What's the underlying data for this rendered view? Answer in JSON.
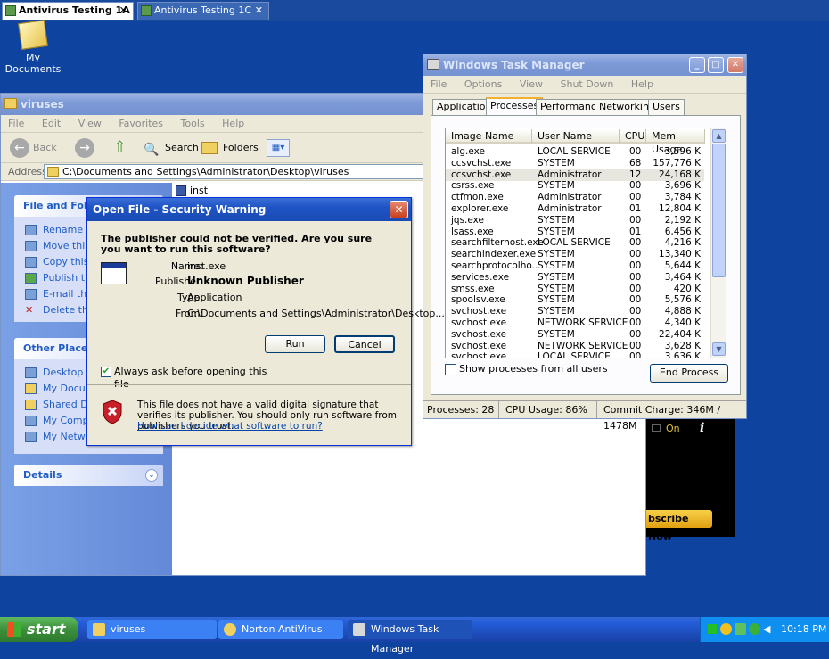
{
  "vm_tabs": [
    {
      "label": "Antivirus Testing 1A",
      "active": true
    },
    {
      "label": "Antivirus Testing 1C",
      "active": false
    }
  ],
  "desktop": {
    "my_documents": "My Documents"
  },
  "explorer": {
    "title": "viruses",
    "menu": [
      "File",
      "Edit",
      "View",
      "Favorites",
      "Tools",
      "Help"
    ],
    "toolbar": {
      "back": "Back",
      "search": "Search",
      "folders": "Folders"
    },
    "address_label": "Address",
    "address": "C:\\Documents and Settings\\Administrator\\Desktop\\viruses",
    "file_item": "inst",
    "tasks_title": "File and Folder Tasks",
    "file_tasks": [
      "Rename this file",
      "Move this file",
      "Copy this file",
      "Publish this file",
      "E-mail this file",
      "Delete this file"
    ],
    "other_places_title": "Other Places",
    "other_places": [
      "Desktop",
      "My Documents",
      "Shared Documents",
      "My Computer",
      "My Network Places"
    ],
    "details_title": "Details"
  },
  "security_dialog": {
    "title": "Open File - Security Warning",
    "question": "The publisher could not be verified.  Are you sure you want to run this software?",
    "name_label": "Name:",
    "name_value": "inst.exe",
    "publisher_label": "Publisher:",
    "publisher_value": "Unknown Publisher",
    "type_label": "Type:",
    "type_value": "Application",
    "from_label": "From:",
    "from_value": "C:\\Documents and Settings\\Administrator\\Desktop...",
    "run_label": "Run",
    "cancel_label": "Cancel",
    "checkbox_label": "Always ask before opening this file",
    "checkbox_checked": true,
    "warning_text": "This file does not have a valid digital signature that verifies its publisher.  You should only run software from publishers you trust.",
    "help_link": "How can I decide what software to run?"
  },
  "task_manager": {
    "title": "Windows Task Manager",
    "menu": [
      "File",
      "Options",
      "View",
      "Shut Down",
      "Help"
    ],
    "tabs": [
      "Applications",
      "Processes",
      "Performance",
      "Networking",
      "Users"
    ],
    "active_tab": "Processes",
    "columns": [
      "Image Name",
      "User Name",
      "CPU",
      "Mem Usage"
    ],
    "processes": [
      {
        "name": "alg.exe",
        "user": "LOCAL SERVICE",
        "cpu": "00",
        "mem": "3,596 K"
      },
      {
        "name": "ccsvchst.exe",
        "user": "SYSTEM",
        "cpu": "68",
        "mem": "157,776 K"
      },
      {
        "name": "ccsvchst.exe",
        "user": "Administrator",
        "cpu": "12",
        "mem": "24,168 K"
      },
      {
        "name": "csrss.exe",
        "user": "SYSTEM",
        "cpu": "00",
        "mem": "3,696 K"
      },
      {
        "name": "ctfmon.exe",
        "user": "Administrator",
        "cpu": "00",
        "mem": "3,784 K"
      },
      {
        "name": "explorer.exe",
        "user": "Administrator",
        "cpu": "01",
        "mem": "12,804 K"
      },
      {
        "name": "jqs.exe",
        "user": "SYSTEM",
        "cpu": "00",
        "mem": "2,192 K"
      },
      {
        "name": "lsass.exe",
        "user": "SYSTEM",
        "cpu": "01",
        "mem": "6,456 K"
      },
      {
        "name": "searchfilterhost.exe",
        "user": "LOCAL SERVICE",
        "cpu": "00",
        "mem": "4,216 K"
      },
      {
        "name": "searchindexer.exe",
        "user": "SYSTEM",
        "cpu": "00",
        "mem": "13,340 K"
      },
      {
        "name": "searchprotocolho...",
        "user": "SYSTEM",
        "cpu": "00",
        "mem": "5,644 K"
      },
      {
        "name": "services.exe",
        "user": "SYSTEM",
        "cpu": "00",
        "mem": "3,464 K"
      },
      {
        "name": "smss.exe",
        "user": "SYSTEM",
        "cpu": "00",
        "mem": "420 K"
      },
      {
        "name": "spoolsv.exe",
        "user": "SYSTEM",
        "cpu": "00",
        "mem": "5,576 K"
      },
      {
        "name": "svchost.exe",
        "user": "SYSTEM",
        "cpu": "00",
        "mem": "4,888 K"
      },
      {
        "name": "svchost.exe",
        "user": "NETWORK SERVICE",
        "cpu": "00",
        "mem": "4,340 K"
      },
      {
        "name": "svchost.exe",
        "user": "SYSTEM",
        "cpu": "00",
        "mem": "22,404 K"
      },
      {
        "name": "svchost.exe",
        "user": "NETWORK SERVICE",
        "cpu": "00",
        "mem": "3,628 K"
      },
      {
        "name": "svchost.exe",
        "user": "LOCAL SERVICE",
        "cpu": "00",
        "mem": "3,636 K"
      }
    ],
    "selected_row": 2,
    "show_all_label": "Show processes from all users",
    "end_process_label": "End Process",
    "status_processes": "Processes: 28",
    "status_cpu": "CPU Usage: 86%",
    "status_commit": "Commit Charge: 346M / 1478M"
  },
  "norton_panel": {
    "on_label": "On",
    "info": "i",
    "subscribe_label": "bscribe Now"
  },
  "taskbar": {
    "start_label": "start",
    "buttons": [
      "viruses",
      "Norton AntiVirus",
      "Windows Task Manager"
    ],
    "clock": "10:18 PM"
  }
}
